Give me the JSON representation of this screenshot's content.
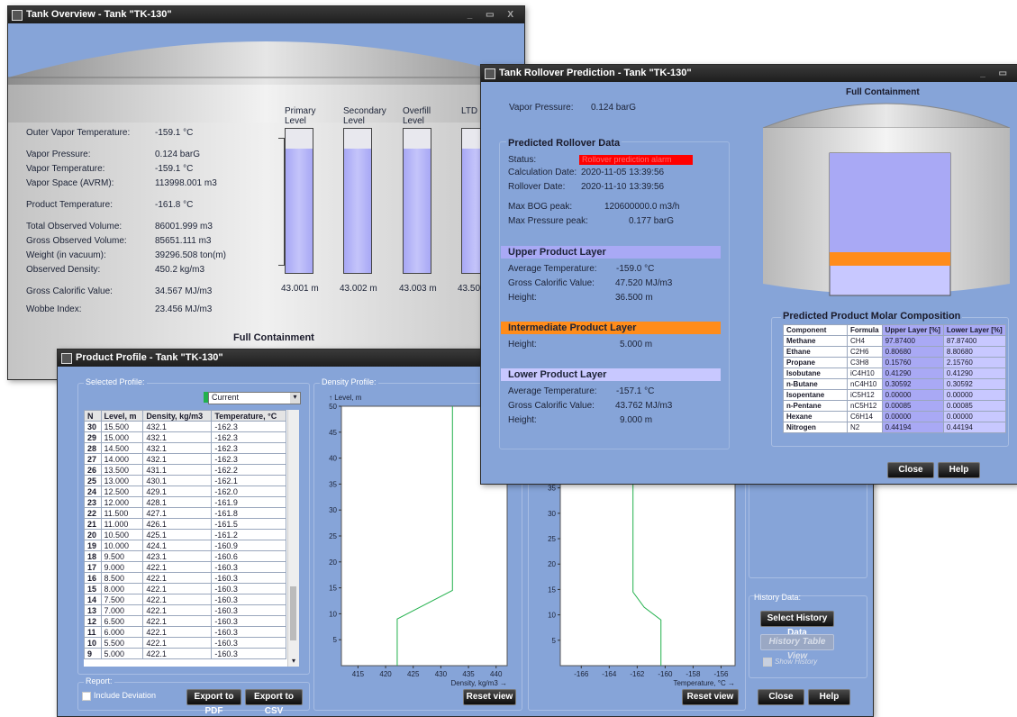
{
  "overview": {
    "title": "Tank Overview - Tank \"TK-130\"",
    "labels": [
      {
        "label": "Outer Vapor Temperature:",
        "value": "-159.1 °C"
      },
      {
        "label": "Vapor Pressure:",
        "value": "0.124 barG"
      },
      {
        "label": "Vapor Temperature:",
        "value": "-159.1 °C"
      },
      {
        "label": "Vapor Space (AVRM):",
        "value": "113998.001 m3"
      },
      {
        "label": "Product Temperature:",
        "value": "-161.8 °C"
      },
      {
        "label": "Total Observed Volume:",
        "value": "86001.999 m3"
      },
      {
        "label": "Gross Observed Volume:",
        "value": "85651.111 m3"
      },
      {
        "label": "Weight (in vacuum):",
        "value": "39296.508 ton(m)"
      },
      {
        "label": "Observed Density:",
        "value": "450.2 kg/m3"
      },
      {
        "label": "Gross Calorific Value:",
        "value": "34.567 MJ/m3"
      },
      {
        "label": "Wobbe Index:",
        "value": "23.456 MJ/m3"
      }
    ],
    "levels": [
      {
        "name": "Primary\nLevel",
        "value": "43.001 m",
        "fill": 0.86
      },
      {
        "name": "Secondary\nLevel",
        "value": "43.002 m",
        "fill": 0.86
      },
      {
        "name": "Overfill\nLevel",
        "value": "43.003 m",
        "fill": 0.86
      },
      {
        "name": "LTD",
        "value": "43.50",
        "fill": 0.86
      }
    ],
    "containment": "Full Containment"
  },
  "profile": {
    "title": "Product Profile - Tank \"TK-130\"",
    "selected_profile_label": "Selected Profile:",
    "profile_select": "Current",
    "columns": [
      "N",
      "Level, m",
      "Density, kg/m3",
      "Temperature, °C"
    ],
    "rows": [
      [
        "30",
        "15.500",
        "432.1",
        "-162.3"
      ],
      [
        "29",
        "15.000",
        "432.1",
        "-162.3"
      ],
      [
        "28",
        "14.500",
        "432.1",
        "-162.3"
      ],
      [
        "27",
        "14.000",
        "432.1",
        "-162.3"
      ],
      [
        "26",
        "13.500",
        "431.1",
        "-162.2"
      ],
      [
        "25",
        "13.000",
        "430.1",
        "-162.1"
      ],
      [
        "24",
        "12.500",
        "429.1",
        "-162.0"
      ],
      [
        "23",
        "12.000",
        "428.1",
        "-161.9"
      ],
      [
        "22",
        "11.500",
        "427.1",
        "-161.8"
      ],
      [
        "21",
        "11.000",
        "426.1",
        "-161.5"
      ],
      [
        "20",
        "10.500",
        "425.1",
        "-161.2"
      ],
      [
        "19",
        "10.000",
        "424.1",
        "-160.9"
      ],
      [
        "18",
        "9.500",
        "423.1",
        "-160.6"
      ],
      [
        "17",
        "9.000",
        "422.1",
        "-160.3"
      ],
      [
        "16",
        "8.500",
        "422.1",
        "-160.3"
      ],
      [
        "15",
        "8.000",
        "422.1",
        "-160.3"
      ],
      [
        "14",
        "7.500",
        "422.1",
        "-160.3"
      ],
      [
        "13",
        "7.000",
        "422.1",
        "-160.3"
      ],
      [
        "12",
        "6.500",
        "422.1",
        "-160.3"
      ],
      [
        "11",
        "6.000",
        "422.1",
        "-160.3"
      ],
      [
        "10",
        "5.500",
        "422.1",
        "-160.3"
      ],
      [
        "9",
        "5.000",
        "422.1",
        "-160.3"
      ]
    ],
    "report_label": "Report:",
    "include_deviation": "Include Deviation",
    "export_pdf": "Export to PDF",
    "export_csv": "Export to CSV",
    "density_profile_label": "Density Profile:",
    "reset_view": "Reset view",
    "history_label": "History Data:",
    "select_history": "Select History Data",
    "history_table": "History Table View",
    "show_history": "Show History",
    "close": "Close",
    "help": "Help"
  },
  "chart_data": [
    {
      "type": "line",
      "xlabel": "Density, kg/m3",
      "ylabel": "Level, m",
      "xlim": [
        412,
        442
      ],
      "ylim": [
        0,
        50
      ],
      "x_ticks": [
        "415",
        "420",
        "425",
        "430",
        "435",
        "440"
      ],
      "y_ticks": [
        "5",
        "10",
        "15",
        "20",
        "25",
        "30",
        "35",
        "40",
        "45",
        "50"
      ],
      "series": [
        {
          "x": [
            422.1,
            422.1,
            432.1,
            432.1,
            432.1
          ],
          "y": [
            0,
            9,
            14.5,
            15.5,
            50
          ]
        }
      ]
    },
    {
      "type": "line",
      "xlabel": "Temperature, °C",
      "ylabel": "",
      "xlim": [
        -167.5,
        -155
      ],
      "ylim": [
        0,
        36
      ],
      "x_ticks": [
        "-166",
        "-164",
        "-162",
        "-160",
        "-158",
        "-156"
      ],
      "y_ticks": [
        "5",
        "10",
        "15",
        "20",
        "25",
        "30",
        "35"
      ],
      "series": [
        {
          "x": [
            -160.3,
            -160.3,
            -161.5,
            -162.3,
            -162.3
          ],
          "y": [
            0,
            9,
            11.5,
            14.5,
            36
          ]
        }
      ]
    }
  ],
  "rollover": {
    "title": "Tank Rollover Prediction - Tank \"TK-130\"",
    "vapor_pressure_label": "Vapor Pressure:",
    "vapor_pressure_value": "0.124  barG",
    "predicted_title": "Predicted Rollover Data",
    "status_label": "Status:",
    "status_value": "Rollover prediction alarm",
    "status_color": "#ff0000",
    "calc_date_label": "Calculation Date:",
    "calc_date_value": "2020-11-05 13:39:56",
    "rollover_date_label": "Rollover Date:",
    "rollover_date_value": "2020-11-10 13:39:56",
    "max_bog_label": "Max BOG peak:",
    "max_bog_value": "120600000.0  m3/h",
    "max_pressure_label": "Max Pressure peak:",
    "max_pressure_value": "0.177  barG",
    "upper_title": "Upper Product Layer",
    "upper_color": "#a9a9f5",
    "upper_avg_label": "Average Temperature:",
    "upper_avg_value": "-159.0  °C",
    "upper_gcv_label": "Gross Calorific Value:",
    "upper_gcv_value": "47.520  MJ/m3",
    "upper_height_label": "Height:",
    "upper_height_value": "36.500  m",
    "inter_title": "Intermediate Product Layer",
    "inter_color": "#ff8c1a",
    "inter_height_label": "Height:",
    "inter_height_value": "5.000  m",
    "lower_title": "Lower Product Layer",
    "lower_color": "#c8c8ff",
    "lower_avg_label": "Average Temperature:",
    "lower_avg_value": "-157.1  °C",
    "lower_gcv_label": "Gross Calorific Value:",
    "lower_gcv_value": "43.762  MJ/m3",
    "lower_height_label": "Height:",
    "lower_height_value": "9.000  m",
    "containment": "Full Containment",
    "composition_title": "Predicted Product Molar Composition",
    "composition_columns": [
      "Component",
      "Formula",
      "Upper Layer [%]",
      "Lower Layer [%]"
    ],
    "composition_rows": [
      [
        "Methane",
        "CH4",
        "97.87400",
        "87.87400"
      ],
      [
        "Ethane",
        "C2H6",
        "0.80680",
        "8.80680"
      ],
      [
        "Propane",
        "C3H8",
        "0.15760",
        "2.15760"
      ],
      [
        "Isobutane",
        "iC4H10",
        "0.41290",
        "0.41290"
      ],
      [
        "n-Butane",
        "nC4H10",
        "0.30592",
        "0.30592"
      ],
      [
        "Isopentane",
        "iC5H12",
        "0.00000",
        "0.00000"
      ],
      [
        "n-Pentane",
        "nC5H12",
        "0.00085",
        "0.00085"
      ],
      [
        "Hexane",
        "C6H14",
        "0.00000",
        "0.00000"
      ],
      [
        "Nitrogen",
        "N2",
        "0.44194",
        "0.44194"
      ]
    ],
    "close": "Close",
    "help": "Help"
  }
}
